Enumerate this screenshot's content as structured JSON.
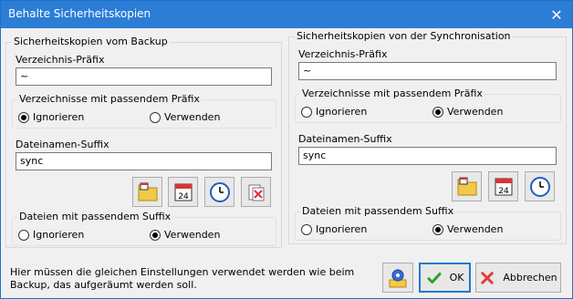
{
  "window": {
    "title": "Behalte Sicherheitskopien"
  },
  "left": {
    "group_title": "Sicherheitskopien vom Backup",
    "prefix_label": "Verzeichnis-Präfix",
    "prefix_value": "~",
    "dirs_group_title": "Verzeichnisse mit passendem Präfix",
    "dirs_options": {
      "ignore": "Ignorieren",
      "use": "Verwenden"
    },
    "dirs_selected": "ignore",
    "suffix_label": "Dateinamen-Suffix",
    "suffix_value": "sync",
    "files_group_title": "Dateien mit passendem Suffix",
    "files_options": {
      "ignore": "Ignorieren",
      "use": "Verwenden"
    },
    "files_selected": "use"
  },
  "right": {
    "group_title": "Sicherheitskopien von der Synchronisation",
    "prefix_label": "Verzeichnis-Präfix",
    "prefix_value": "~",
    "dirs_group_title": "Verzeichnisse mit passendem Präfix",
    "dirs_options": {
      "ignore": "Ignorieren",
      "use": "Verwenden"
    },
    "dirs_selected": "use",
    "suffix_label": "Dateinamen-Suffix",
    "suffix_value": "sync",
    "files_group_title": "Dateien mit passendem Suffix",
    "files_options": {
      "ignore": "Ignorieren",
      "use": "Verwenden"
    },
    "files_selected": "use"
  },
  "calendar_day": "24",
  "footer": {
    "hint_text": "Hier müssen die gleichen Einstellungen verwendet werden wie beim Backup, das aufgeräumt werden soll.",
    "ok_label": "OK",
    "cancel_label": "Abbrechen"
  },
  "colors": {
    "titlebar": "#2b7dd6",
    "ok_check": "#2aa12a",
    "cancel_x": "#e23b3b",
    "primary_border": "#1f78d1"
  }
}
